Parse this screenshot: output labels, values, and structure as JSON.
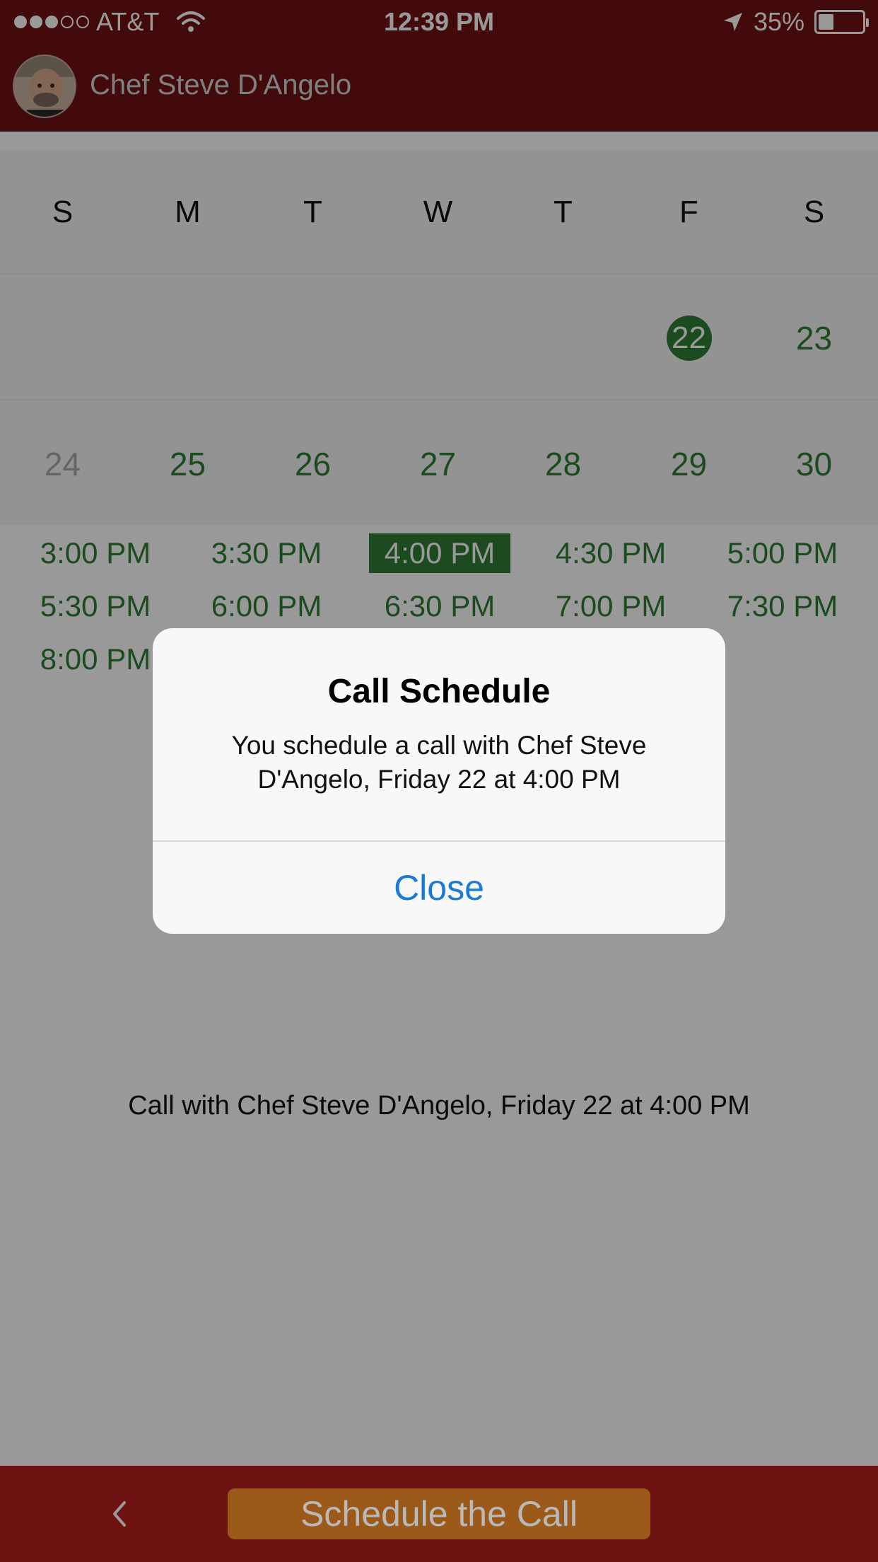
{
  "status_bar": {
    "carrier": "AT&T",
    "time": "12:39 PM",
    "battery": "35%",
    "battery_level": 0.35,
    "signal_bars": 3,
    "signal_total": 5
  },
  "nav": {
    "title": "Chef Steve D'Angelo"
  },
  "calendar": {
    "weekdays": [
      "S",
      "M",
      "T",
      "W",
      "T",
      "F",
      "S"
    ],
    "week1": [
      "",
      "",
      "",
      "",
      "",
      "22",
      "23"
    ],
    "week2": [
      "24",
      "25",
      "26",
      "27",
      "28",
      "29",
      "30"
    ],
    "selected_day": "22"
  },
  "time_slots": [
    [
      "3:00 PM",
      "3:30 PM",
      "4:00 PM",
      "4:30 PM",
      "5:00 PM"
    ],
    [
      "5:30 PM",
      "6:00 PM",
      "6:30 PM",
      "7:00 PM",
      "7:30 PM"
    ],
    [
      "8:00 PM"
    ]
  ],
  "selected_time": "4:00 PM",
  "summary": "Call with Chef Steve D'Angelo, Friday 22 at 4:00 PM",
  "alert": {
    "title": "Call Schedule",
    "message": "You schedule a call with Chef Steve D'Angelo, Friday 22 at 4:00 PM",
    "button": "Close"
  },
  "bottom_bar": {
    "back_icon": "chevron-left-icon",
    "action_label": "Schedule the Call"
  },
  "colors": {
    "brand": "#6e1212",
    "accent_green": "#2e7d32",
    "action": "#9c5a1a",
    "link_blue": "#1a7ad9"
  }
}
